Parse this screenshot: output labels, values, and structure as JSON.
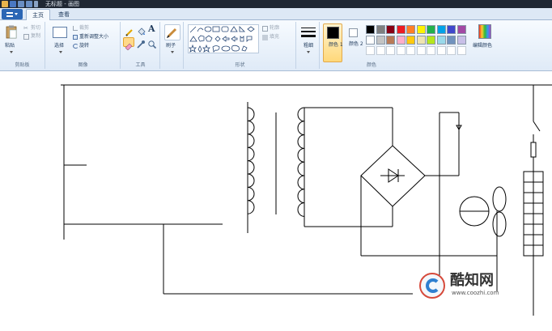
{
  "window": {
    "title": "无标题 - 画图"
  },
  "tabs": [
    {
      "label": "主页",
      "active": true
    },
    {
      "label": "查看",
      "active": false
    }
  ],
  "clipboard": {
    "paste_label": "粘贴",
    "cut_label": "剪切",
    "copy_label": "复制",
    "group_label": "剪贴板"
  },
  "image": {
    "select_label": "选择",
    "crop_label": "裁剪",
    "resize_label": "重新调整大小",
    "rotate_label": "旋转",
    "group_label": "图像"
  },
  "tools": {
    "group_label": "工具"
  },
  "brushes": {
    "label": "刷子"
  },
  "shapes": {
    "outline_label": "轮廓",
    "fill_label": "填充",
    "group_label": "形状"
  },
  "size": {
    "label": "粗细"
  },
  "colors": {
    "color1_label": "颜色 1",
    "color2_label": "颜色 2",
    "edit_label": "编辑颜色",
    "group_label": "颜色",
    "color1": "#000000",
    "color2": "#ffffff",
    "palette": [
      "#000000",
      "#7f7f7f",
      "#880015",
      "#ed1c24",
      "#ff7f27",
      "#fff200",
      "#22b14c",
      "#00a2e8",
      "#3f48cc",
      "#a349a4",
      "#ffffff",
      "#c3c3c3",
      "#b97a57",
      "#ffaec9",
      "#ffc90e",
      "#efe4b0",
      "#b5e61d",
      "#99d9ea",
      "#7092be",
      "#c8bfe7"
    ]
  },
  "watermark": {
    "brand": "酷知网",
    "url": "www.coozhi.com"
  }
}
